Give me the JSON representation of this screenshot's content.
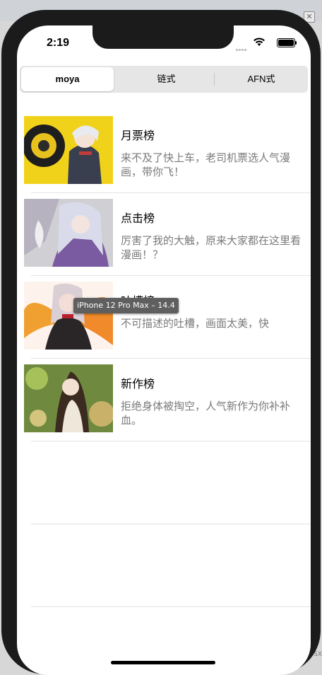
{
  "status_bar": {
    "time": "2:19"
  },
  "segmented_control": {
    "items": [
      {
        "label": "moya",
        "selected": true
      },
      {
        "label": "链式",
        "selected": false
      },
      {
        "label": "AFN式",
        "selected": false
      }
    ]
  },
  "list": {
    "rows": [
      {
        "title": "月票榜",
        "subtitle": "来不及了快上车，老司机票选人气漫画，带你飞！"
      },
      {
        "title": "点击榜",
        "subtitle": "厉害了我的大触，原来大家都在这里看漫画！？"
      },
      {
        "title": "吐槽榜",
        "subtitle": "不可描述的吐槽，画面太美，快"
      },
      {
        "title": "新作榜",
        "subtitle": "拒绝身体被掏空，人气新作为你补补血。"
      }
    ]
  },
  "tooltip": {
    "text": "iPhone 12 Pro Max – 14.4"
  },
  "background": {
    "close_glyph": "✕",
    "side_text": "OSX"
  },
  "colors": {
    "segment_bg": "#e6e6e6",
    "separator": "#e3e3e3",
    "subtitle": "#7a7a7a",
    "device_frame": "#1b1b1b"
  }
}
